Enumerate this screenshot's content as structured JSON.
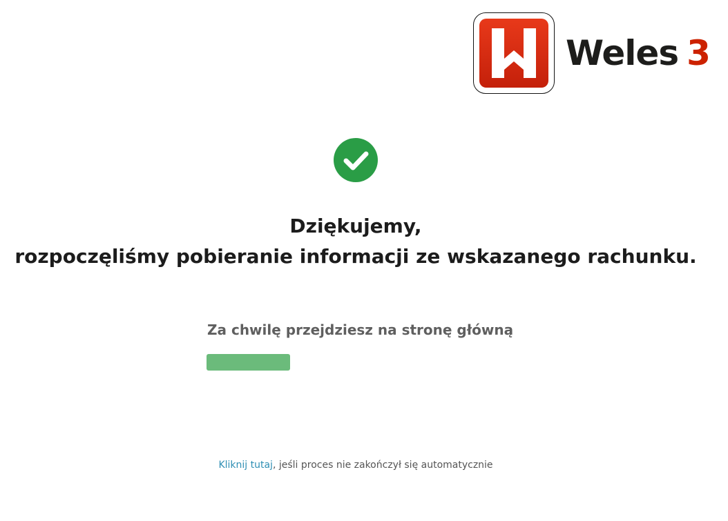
{
  "brand": {
    "name": "Weles",
    "version": "3",
    "logo_icon": "weles-w-logo-icon",
    "colors": {
      "logo_red": "#d52a10",
      "version_red": "#cc2200"
    }
  },
  "status": {
    "icon": "check-circle-icon",
    "color": "#2a9d46"
  },
  "message": {
    "line1": "Dziękujemy,",
    "line2": "rozpoczęliśmy pobieranie informacji ze wskazanego rachunku."
  },
  "redirect": {
    "text": "Za chwilę przejdziesz na stronę główną",
    "progress_fraction": 0.28,
    "progress_color": "#6bbb7b"
  },
  "footer": {
    "link_text": "Kliknij tutaj",
    "rest_text": ", jeśli proces nie zakończył się automatycznie"
  }
}
